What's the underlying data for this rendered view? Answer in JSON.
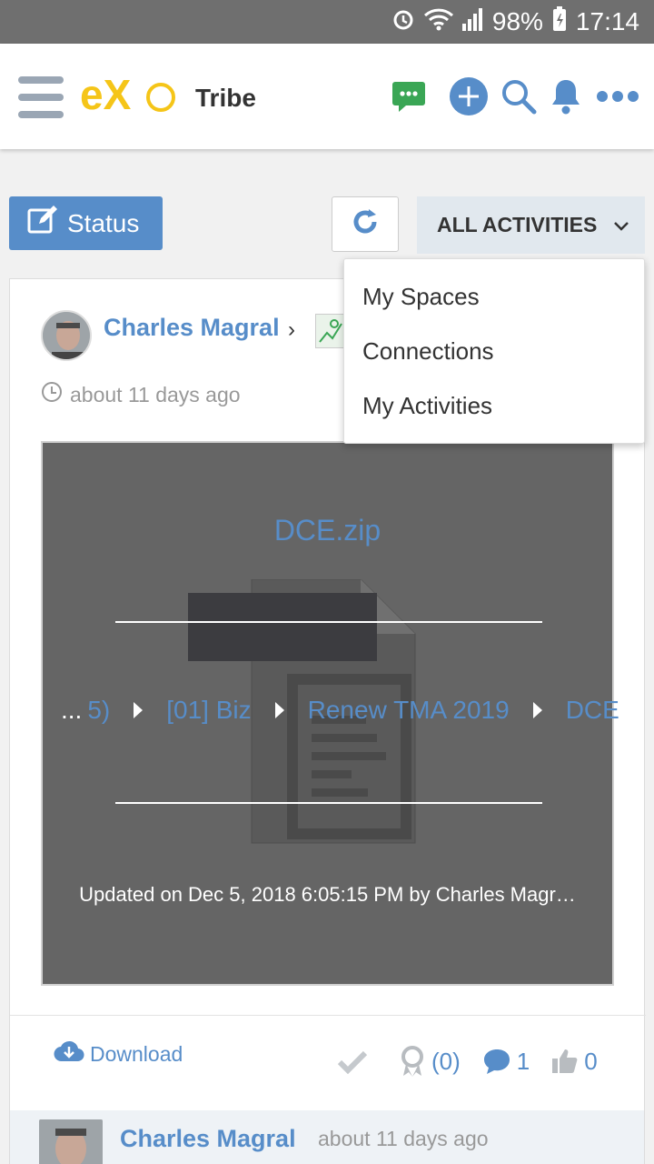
{
  "status_bar": {
    "battery": "98%",
    "time": "17:14"
  },
  "header": {
    "logo_text": "eXo",
    "network_name": "Tribe"
  },
  "toolbar": {
    "status_label": "Status",
    "filter_label": "ALL ACTIVITIES"
  },
  "filter_menu": {
    "items": [
      "My Spaces",
      "Connections",
      "My Activities"
    ]
  },
  "activity": {
    "author": "Charles Magral",
    "time": "about 11 days ago",
    "file_name": "DCE.zip",
    "breadcrumb": [
      "...",
      "5)",
      "[01] Biz",
      "Renew TMA 2019",
      "DCE"
    ],
    "updated": "Updated on Dec 5, 2018 6:05:15 PM by Charles Magr…",
    "download_label": "Download",
    "kudos_count": "(0)",
    "comment_count": "1",
    "like_count": "0"
  },
  "comment": {
    "author": "Charles Magral",
    "time": "about 11 days ago"
  },
  "colors": {
    "brand_blue": "#578dc9",
    "logo_yellow": "#f5c518",
    "chat_green": "#3aa655"
  }
}
